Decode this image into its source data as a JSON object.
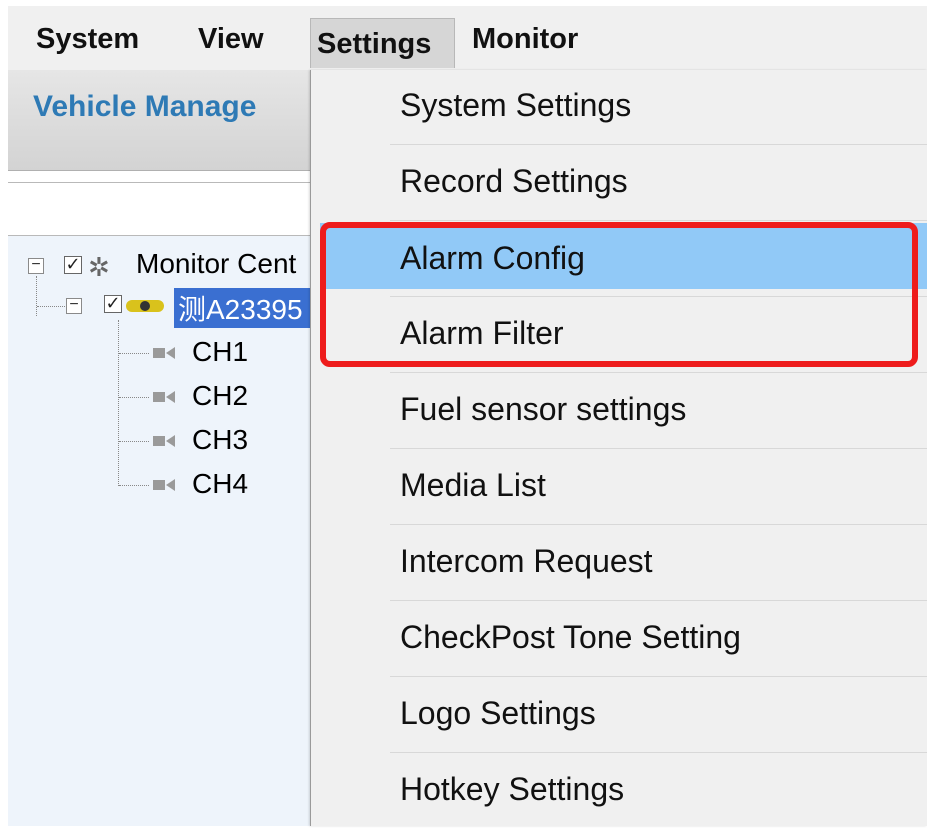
{
  "menubar": {
    "items": [
      {
        "label": "System"
      },
      {
        "label": "View"
      },
      {
        "label": "Settings",
        "active": true
      },
      {
        "label": "Monitor"
      }
    ]
  },
  "toolbar": {
    "title": "Vehicle Manage"
  },
  "tree": {
    "root_label": "Monitor Cent",
    "vehicle_label": "测A23395",
    "channels": [
      "CH1",
      "CH2",
      "CH3",
      "CH4"
    ]
  },
  "settings_menu": {
    "items": [
      {
        "label": "System Settings"
      },
      {
        "label": "Record Settings"
      },
      {
        "label": "Alarm Config",
        "hover": true
      },
      {
        "label": "Alarm Filter"
      },
      {
        "label": "Fuel sensor settings"
      },
      {
        "label": "Media List"
      },
      {
        "label": "Intercom Request"
      },
      {
        "label": "CheckPost Tone Setting"
      },
      {
        "label": "Logo Settings"
      },
      {
        "label": "Hotkey Settings"
      }
    ]
  },
  "colors": {
    "highlight_red": "#ee1c1c",
    "hover_blue": "#91c9f7",
    "title_blue": "#2e7ab5",
    "selection_blue": "#3a6fd1"
  }
}
